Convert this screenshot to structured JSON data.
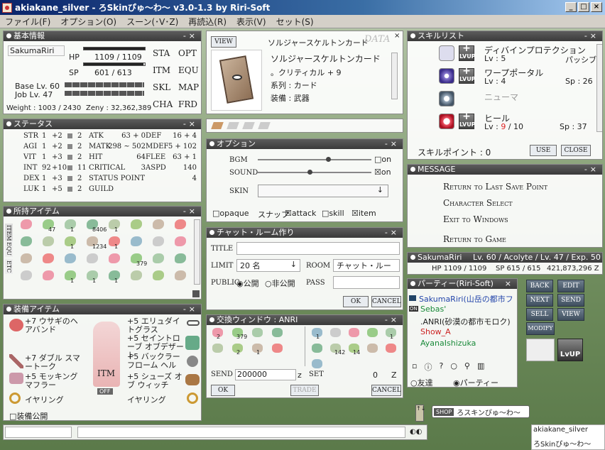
{
  "window": {
    "title": "akiakane_silver - ろSkinぴゅ～わ～ v3.0-1.3 by Riri-Soft",
    "buttons": [
      "_",
      "□",
      "×"
    ]
  },
  "menu": [
    "ファイル(F)",
    "オプション(O)",
    "スーン(･V･Z)",
    "再読込(R)",
    "表示(V)",
    "セット(S)"
  ],
  "basic": {
    "title": "基本情報",
    "name": "SakumaRiri",
    "hp_label": "HP",
    "hp": "1109 / 1109",
    "hp_frac": 1.0,
    "sp_label": "SP",
    "sp": "601 / 613",
    "sp_frac": 0.98,
    "base_lv": "Base Lv. 60",
    "job_lv": "Job Lv. 47",
    "weight": "Weight : 1003 / 2430",
    "zeny": "Zeny : 32,362,389",
    "buttons": [
      "STA",
      "OPT",
      "ITM",
      "EQU",
      "SKL",
      "MAP",
      "CHA",
      "FRD"
    ]
  },
  "status": {
    "title": "ステータス",
    "rows": [
      {
        "stat": "STR",
        "base": "1",
        "bonus": "+2",
        "pts": "2"
      },
      {
        "stat": "AGI",
        "base": "1",
        "bonus": "+2",
        "pts": "2"
      },
      {
        "stat": "VIT",
        "base": "1",
        "bonus": "+3",
        "pts": "2"
      },
      {
        "stat": "INT",
        "base": "92",
        "bonus": "+10",
        "pts": "11"
      },
      {
        "stat": "DEX",
        "base": "1",
        "bonus": "+3",
        "pts": "2"
      },
      {
        "stat": "LUK",
        "base": "1",
        "bonus": "+5",
        "pts": "2"
      }
    ],
    "mid": [
      {
        "k": "ATK",
        "v": "63 + 0"
      },
      {
        "k": "MATK",
        "v": "298 ~ 502"
      },
      {
        "k": "HIT",
        "v": "64"
      },
      {
        "k": "CRITICAL",
        "v": "3"
      },
      {
        "k": "STATUS POINT",
        "v": ""
      },
      {
        "k": "GUILD",
        "v": ""
      }
    ],
    "right": [
      {
        "k": "DEF",
        "v": "16 + 4"
      },
      {
        "k": "MDEF",
        "v": "5 + 102"
      },
      {
        "k": "FLEE",
        "v": "63 + 1"
      },
      {
        "k": "ASPD",
        "v": "140"
      },
      {
        "k": "",
        "v": "4"
      }
    ]
  },
  "items": {
    "title": "所持アイテム",
    "tabs": [
      "ITEM",
      "EQU",
      "ETC"
    ],
    "row1": [
      "",
      "47",
      "1",
      "8406",
      "1",
      "",
      "",
      ""
    ],
    "row2": [
      "",
      "",
      "1",
      "1234",
      "1",
      "",
      "",
      ""
    ],
    "row3": [
      "",
      "",
      "",
      "",
      "",
      "379",
      "",
      ""
    ],
    "row4": [
      "",
      "",
      "1",
      "1",
      "1",
      "",
      "",
      ""
    ]
  },
  "equip": {
    "title": "装備アイテム",
    "left": [
      "+7 ウサギのヘアバンド",
      "+7 ダブル スマートーク",
      "+5 モッキング マフラー",
      "イヤリング"
    ],
    "right": [
      "+5 エリュダイトグラス",
      "+5 セイントローブ オブデザート",
      "+5 バックラー フローム ヘル",
      "+5 シューズ オブ ウィッチ",
      "イヤリング"
    ],
    "itm": "ITM",
    "off": "OFF",
    "public": "□装備公開"
  },
  "card": {
    "title": "ソルジャースケルトンカード",
    "view": "VIEW",
    "data": "DATA",
    "name": "ソルジャースケルトンカード",
    "effect": "。クリティカル + 9",
    "type_label": "系列 : カード",
    "slot_label": "装備 : 武器"
  },
  "option": {
    "title": "オプション",
    "bgm": "BGM",
    "sound": "SOUND",
    "skin": "SKIN",
    "on1": "□on",
    "on2": "☒on",
    "opaque": "□opaque",
    "snap": "スナップ",
    "attack": "☒attack",
    "skill": "□skill",
    "item": "☒item"
  },
  "chatroom": {
    "title": "チャット・ルーム作り",
    "title_label": "TITLE",
    "limit_label": "LIMIT",
    "limit": "20 名",
    "room_label": "ROOM",
    "room": "チャット・ルー",
    "public_label": "PUBLIC",
    "pub": "◉公開",
    "priv": "○非公開",
    "pass": "PASS",
    "ok": "OK",
    "cancel": "CANCEL"
  },
  "trade": {
    "title": "交換ウィンドウ : ANRI",
    "send": "SEND",
    "amount": "200000",
    "z": "z",
    "set": "SET",
    "zero": "0",
    "z2": "Z",
    "ok": "OK",
    "trade": "TRADE",
    "cancel": "CANCEL",
    "counts": [
      "2",
      "379",
      "",
      "",
      "",
      "2",
      "1",
      "",
      "1",
      "",
      "",
      "",
      "1",
      "",
      "142",
      "14",
      "",
      "",
      ""
    ]
  },
  "skills": {
    "title": "スキルリスト",
    "list": [
      {
        "name": "ディバインプロテクション",
        "lv": "Lv : 5",
        "type": "パッシブ"
      },
      {
        "name": "ワープポータル",
        "lv": "Lv : 4",
        "type": "Sp : 26"
      },
      {
        "name": "ニューマ",
        "lv": "",
        "type": ""
      },
      {
        "name": "ヒール",
        "lv": "Lv :",
        "cur": "9",
        "max": "/ 10",
        "type": "Sp : 37"
      }
    ],
    "points": "スキルポイント : 0",
    "use": "USE",
    "close": "CLOSE",
    "lvup": "LvUP"
  },
  "message": {
    "title": "MESSAGE",
    "items": [
      "Return to Last Save Point",
      "Character Select",
      "Exit to Windows",
      "Return to Game"
    ]
  },
  "charinfo": {
    "name": "SakumaRiri",
    "info": "Lv. 60 / Acolyte / Lv. 47 / Exp. 50 %",
    "hp": "HP 1109 / 1109",
    "sp": "SP 615 / 615",
    "zeny": "421,873,296 Z"
  },
  "party": {
    "title": "パーティー(Riri-Soft)",
    "members": [
      {
        "name": "SakumaRiri(山岳の都市フ",
        "color": "#2244aa"
      },
      {
        "name": "Sebas'",
        "color": "#1a8a3a",
        "tag": "ON"
      },
      {
        "name": ".ANRI(砂漠の都市モロク)",
        "color": "#222"
      },
      {
        "name": "Show_A",
        "color": "#cc2222"
      },
      {
        "name": "AyanaIshizuka",
        "color": "#1a8a3a"
      }
    ],
    "friend": "○友達",
    "party": "◉パーティー"
  },
  "sidebtns": [
    "BACK",
    "EDIT",
    "NEXT",
    "SEND",
    "SELL",
    "VIEW",
    "MODIFY"
  ],
  "lvup": "LvUP",
  "shop": {
    "tag": "SHOP",
    "name": "ろスキンぴゅ～わ～"
  },
  "bottom_right": {
    "user": "akiakane_silver",
    "skin": "ろSkinぴゅ～わ～"
  }
}
